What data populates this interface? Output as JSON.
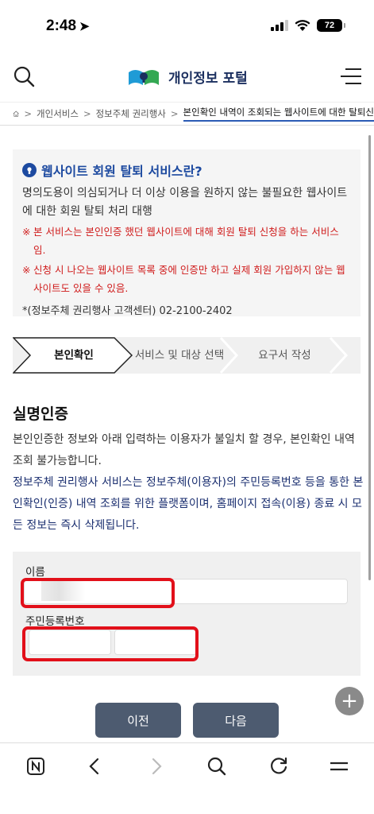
{
  "status": {
    "time": "2:48",
    "battery": "72"
  },
  "header": {
    "logo_text": "개인정보 포털"
  },
  "breadcrumb": {
    "items": [
      "개인서비스",
      "정보주체 권리행사",
      "본인확인 내역이 조회되는 웹사이트에 대한 탈퇴신"
    ]
  },
  "info": {
    "title": "웹사이트 회원 탈퇴 서비스란?",
    "desc": "명의도용이 의심되거나 더 이상 이용을 원하지 않는 불필요한 웹사이트에 대한 회원 탈퇴 처리 대행",
    "note1": "본 서비스는 본인인증 했던 웹사이트에 대해 회원 탈퇴 신청을 하는 서비스임.",
    "note2": "신청 시 나오는 웹사이트 목록 중에 인증만 하고 실제 회원 가입하지 않는 웹사이트도 있을 수 있음.",
    "note_mark": "※",
    "contact": "*(정보주체 권리행사 고객센터) 02-2100-2402"
  },
  "steps": [
    {
      "label": "본인확인"
    },
    {
      "label": "서비스 및 대상 선택"
    },
    {
      "label": "요구서 작성"
    }
  ],
  "section": {
    "title": "실명인증",
    "desc": "본인인증한 정보와 아래 입력하는 이용자가 불일치 할 경우, 본인확인 내역 조회 불가능합니다.",
    "desc2": "정보주체 권리행사 서비스는 정보주체(이용자)의 주민등록번호 등을 통한 본인확인(인증) 내역 조회를 위한 플랫폼이며, 홈페이지 접속(이용) 종료 시 모든 정보는 즉시 삭제됩니다."
  },
  "form": {
    "name_label": "이름",
    "name_value": "",
    "rrn_label": "주민등록번호",
    "rrn_first": "",
    "rrn_second": ""
  },
  "buttons": {
    "prev": "이전",
    "next": "다음"
  },
  "colors": {
    "accent": "#1d4aa0",
    "button": "#4d5b70",
    "warning": "#d01c1c",
    "highlight": "#e2101a"
  },
  "icons": [
    "search-icon",
    "menu-icon",
    "home-icon",
    "plus-icon",
    "tab-icon",
    "back-icon",
    "forward-icon",
    "reload-icon"
  ]
}
